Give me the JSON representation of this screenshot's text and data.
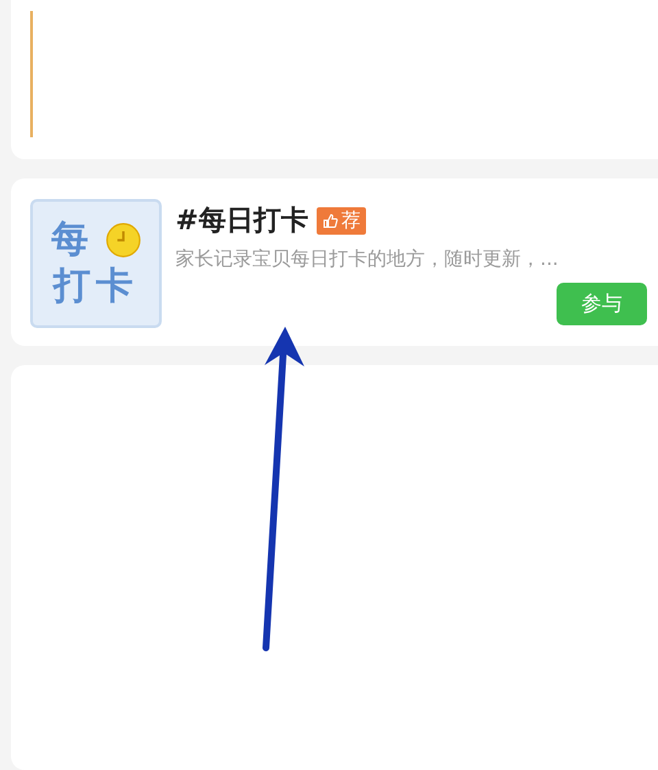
{
  "topic": {
    "thumbnail": {
      "line_1": "每",
      "line_2": "打卡"
    },
    "title": "#每日打卡",
    "tag": "荐",
    "description": "家长记录宝贝每日打卡的地方，随时更新，...",
    "button": "参与"
  }
}
